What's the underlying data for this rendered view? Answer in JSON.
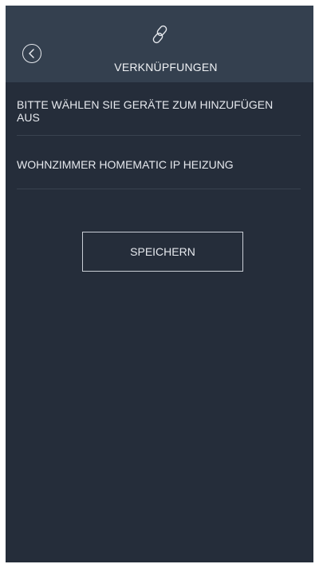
{
  "header": {
    "title": "VERKNÜPFUNGEN",
    "back_icon": "back-circle-icon",
    "link_icon": "link-icon"
  },
  "main": {
    "instruction": "BITTE WÄHLEN SIE GERÄTE ZUM HINZUFÜGEN AUS",
    "devices": [
      {
        "label": "WOHNZIMMER HOMEMATIC IP HEIZUNG"
      }
    ],
    "save_label": "SPEICHERN"
  },
  "colors": {
    "background": "#252d3a",
    "header": "#34404f",
    "text": "#e6e9ee",
    "divider": "#39424f",
    "button_border": "#c9ced6"
  }
}
